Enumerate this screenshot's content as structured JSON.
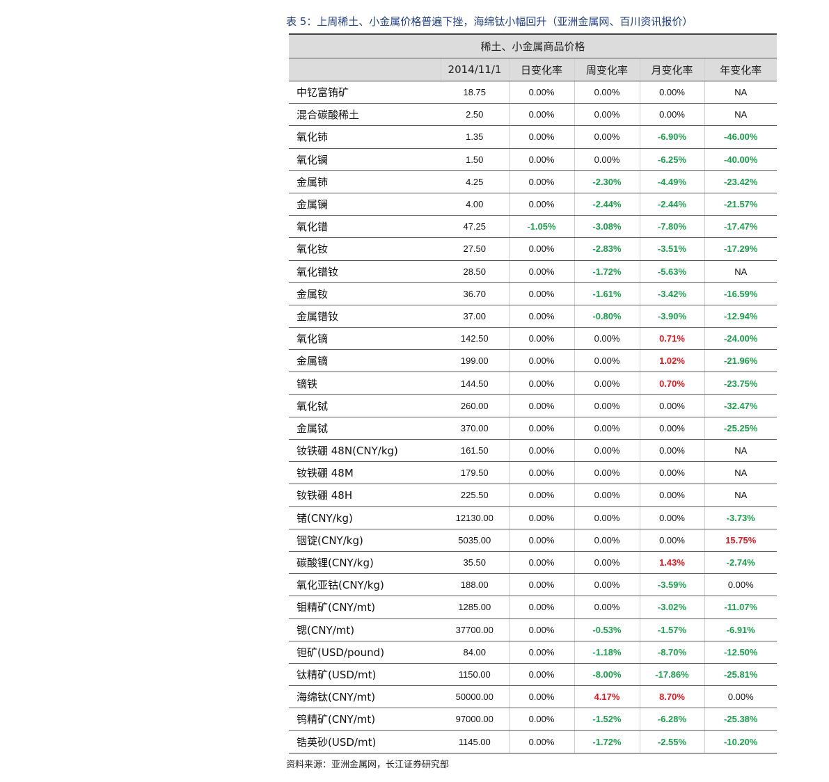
{
  "caption": "表 5：上周稀土、小金属价格普遍下挫，海绵钛小幅回升（亚洲金属网、百川资讯报价）",
  "table": {
    "group_header": "稀土、小金属商品价格",
    "columns": [
      "",
      "2014/11/1",
      "日变化率",
      "周变化率",
      "月变化率",
      "年变化率"
    ],
    "rows": [
      [
        "中钇富铕矿",
        "18.75",
        "0.00%",
        "0.00%",
        "0.00%",
        "NA"
      ],
      [
        "混合碳酸稀土",
        "2.50",
        "0.00%",
        "0.00%",
        "0.00%",
        "NA"
      ],
      [
        "氧化铈",
        "1.35",
        "0.00%",
        "0.00%",
        "-6.90%",
        "-46.00%"
      ],
      [
        "氧化镧",
        "1.50",
        "0.00%",
        "0.00%",
        "-6.25%",
        "-40.00%"
      ],
      [
        "金属铈",
        "4.25",
        "0.00%",
        "-2.30%",
        "-4.49%",
        "-23.42%"
      ],
      [
        "金属镧",
        "4.00",
        "0.00%",
        "-2.44%",
        "-2.44%",
        "-21.57%"
      ],
      [
        "氧化镨",
        "47.25",
        "-1.05%",
        "-3.08%",
        "-7.80%",
        "-17.47%"
      ],
      [
        "氧化钕",
        "27.50",
        "0.00%",
        "-2.83%",
        "-3.51%",
        "-17.29%"
      ],
      [
        "氧化镨钕",
        "28.50",
        "0.00%",
        "-1.72%",
        "-5.63%",
        "NA"
      ],
      [
        "金属钕",
        "36.70",
        "0.00%",
        "-1.61%",
        "-3.42%",
        "-16.59%"
      ],
      [
        "金属镨钕",
        "37.00",
        "0.00%",
        "-0.80%",
        "-3.90%",
        "-12.94%"
      ],
      [
        "氧化镝",
        "142.50",
        "0.00%",
        "0.00%",
        "0.71%",
        "-24.00%"
      ],
      [
        "金属镝",
        "199.00",
        "0.00%",
        "0.00%",
        "1.02%",
        "-21.96%"
      ],
      [
        "镝铁",
        "144.50",
        "0.00%",
        "0.00%",
        "0.70%",
        "-23.75%"
      ],
      [
        "氧化铽",
        "260.00",
        "0.00%",
        "0.00%",
        "0.00%",
        "-32.47%"
      ],
      [
        "金属铽",
        "370.00",
        "0.00%",
        "0.00%",
        "0.00%",
        "-25.25%"
      ],
      [
        "钕铁硼 48N(CNY/kg)",
        "161.50",
        "0.00%",
        "0.00%",
        "0.00%",
        "NA"
      ],
      [
        "钕铁硼 48M",
        "179.50",
        "0.00%",
        "0.00%",
        "0.00%",
        "NA"
      ],
      [
        "钕铁硼 48H",
        "225.50",
        "0.00%",
        "0.00%",
        "0.00%",
        "NA"
      ],
      [
        "锗(CNY/kg)",
        "12130.00",
        "0.00%",
        "0.00%",
        "0.00%",
        "-3.73%"
      ],
      [
        "铟锭(CNY/kg)",
        "5035.00",
        "0.00%",
        "0.00%",
        "0.00%",
        "15.75%"
      ],
      [
        "碳酸锂(CNY/kg)",
        "35.50",
        "0.00%",
        "0.00%",
        "1.43%",
        "-2.74%"
      ],
      [
        "氧化亚钴(CNY/kg)",
        "188.00",
        "0.00%",
        "0.00%",
        "-3.59%",
        "0.00%"
      ],
      [
        "钼精矿(CNY/mt)",
        "1285.00",
        "0.00%",
        "0.00%",
        "-3.02%",
        "-11.07%"
      ],
      [
        "锶(CNY/mt)",
        "37700.00",
        "0.00%",
        "-0.53%",
        "-1.57%",
        "-6.91%"
      ],
      [
        "钽矿(USD/pound)",
        "84.00",
        "0.00%",
        "-1.18%",
        "-8.70%",
        "-12.50%"
      ],
      [
        "钛精矿(USD/mt)",
        "1150.00",
        "0.00%",
        "-8.00%",
        "-17.86%",
        "-25.81%"
      ],
      [
        "海绵钛(CNY/mt)",
        "50000.00",
        "0.00%",
        "4.17%",
        "8.70%",
        "0.00%"
      ],
      [
        "钨精矿(CNY/mt)",
        "97000.00",
        "0.00%",
        "-1.52%",
        "-6.28%",
        "-25.38%"
      ],
      [
        "锆英砂(USD/mt)",
        "1145.00",
        "0.00%",
        "-1.72%",
        "-2.55%",
        "-10.20%"
      ]
    ]
  },
  "colors": {
    "negative": "#18a14a",
    "positive": "#e8161c",
    "caption": "#1f3f8f",
    "header_bg": "#dcdcdc"
  },
  "source": "资料来源：亚洲金属网，长江证券研究部"
}
